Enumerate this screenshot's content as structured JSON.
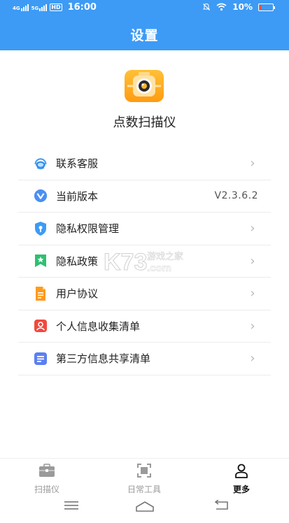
{
  "status_bar": {
    "network1": "4G",
    "network2": "5G",
    "hd": "HD",
    "time": "16:00",
    "battery": "10%"
  },
  "header": {
    "title": "设置"
  },
  "app": {
    "name": "点数扫描仪"
  },
  "menu": {
    "items": [
      {
        "label": "联系客服"
      },
      {
        "label": "当前版本",
        "value": "V2.3.6.2"
      },
      {
        "label": "隐私权限管理"
      },
      {
        "label": "隐私政策"
      },
      {
        "label": "用户协议"
      },
      {
        "label": "个人信息收集清单"
      },
      {
        "label": "第三方信息共享清单"
      }
    ]
  },
  "watermark": {
    "text": "K73",
    "sub": "游戏之家",
    "domain": ".com"
  },
  "tabbar": {
    "tabs": [
      {
        "label": "扫描仪",
        "icon": "briefcase-icon"
      },
      {
        "label": "日常工具",
        "icon": "scan-frame-icon"
      },
      {
        "label": "更多",
        "icon": "person-icon"
      }
    ]
  },
  "colors": {
    "header": "#3d9bf5",
    "app_icon": "#ffa91e"
  }
}
